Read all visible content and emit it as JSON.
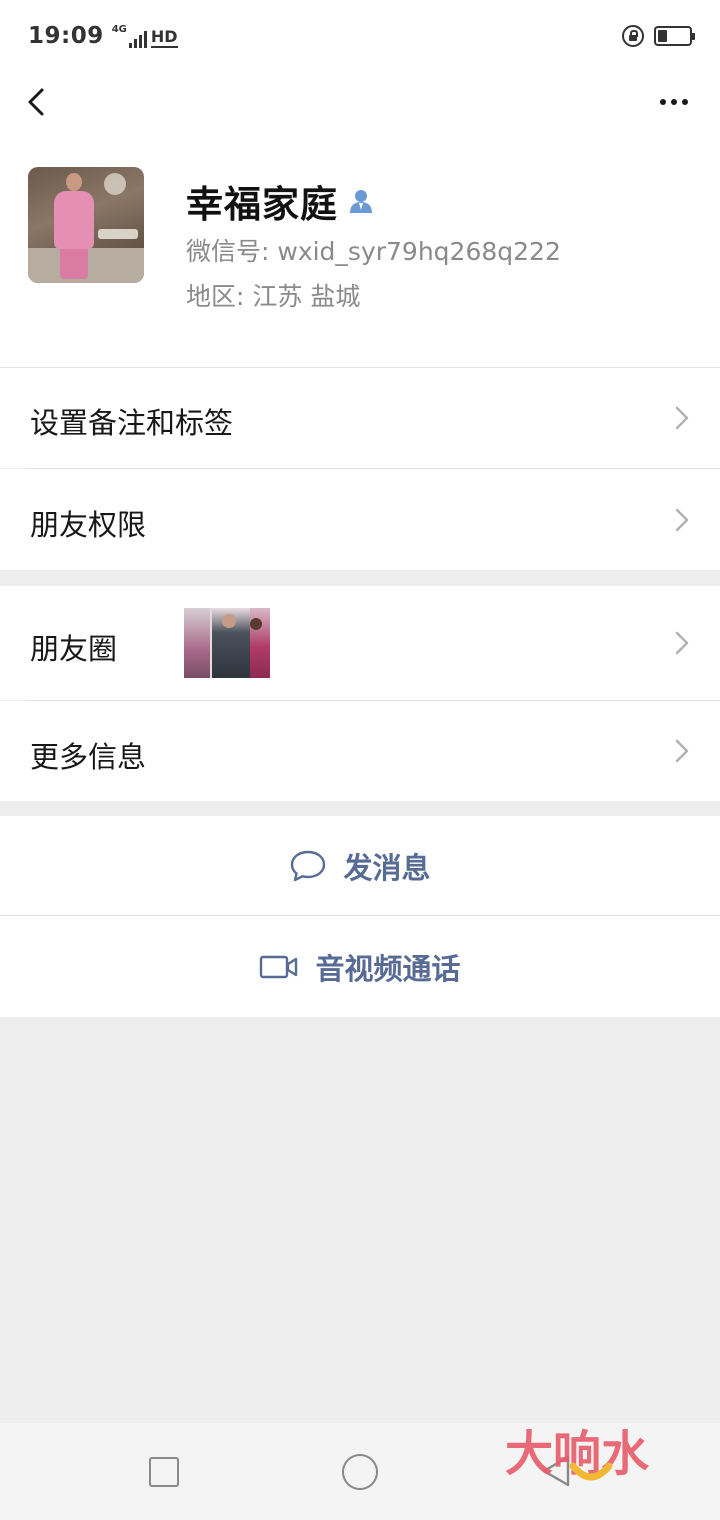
{
  "status_bar": {
    "time": "19:09",
    "network": "4G",
    "hd": "HD",
    "battery_level": 0.3
  },
  "nav": {
    "back_icon": "chevron-left-icon",
    "more_icon": "more-dots-icon"
  },
  "profile": {
    "name": "幸福家庭",
    "wechat_id": "微信号: wxid_syr79hq268q222",
    "region": "地区: 江苏  盐城",
    "contact_icon_color": "#6a9ad6"
  },
  "menu": {
    "remark_tags": "设置备注和标签",
    "friend_permissions": "朋友权限",
    "moments": "朋友圈",
    "more_info": "更多信息"
  },
  "actions": {
    "send_message": "发消息",
    "video_call": "音视频通话",
    "accent_color": "#576b95"
  },
  "watermark": {
    "text": "大响水"
  }
}
